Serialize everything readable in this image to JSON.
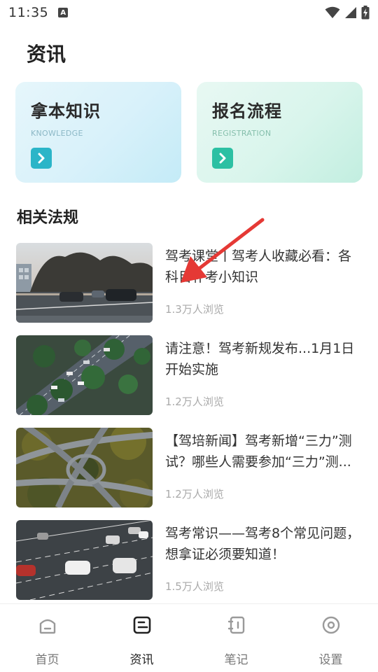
{
  "status_bar": {
    "time": "11:35",
    "notification_icon": "A",
    "icons": [
      "wifi-icon",
      "signal-icon",
      "battery-charging-icon"
    ]
  },
  "page": {
    "title": "资讯"
  },
  "cards": [
    {
      "title": "拿本知识",
      "subtitle": "KNOWLEDGE",
      "icon": "chevron-right-icon",
      "accent": "#2bb5c8"
    },
    {
      "title": "报名流程",
      "subtitle": "REGISTRATION",
      "icon": "chevron-right-icon",
      "accent": "#2cc0a3"
    }
  ],
  "section": {
    "title": "相关法规"
  },
  "news": [
    {
      "title": "驾考课堂丨驾考人收藏必看：各科目补考小知识",
      "views": "1.3万人浏览"
    },
    {
      "title": "请注意！驾考新规发布...1月1日开始实施",
      "views": "1.2万人浏览"
    },
    {
      "title": "【驾培新闻】驾考新增“三力”测试？哪些人需要参加“三力”测...",
      "views": "1.2万人浏览"
    },
    {
      "title": "驾考常识——驾考8个常见问题，想拿证必须要知道！",
      "views": "1.5万人浏览"
    }
  ],
  "bottom_nav": [
    {
      "label": "首页",
      "icon": "home-icon",
      "active": false
    },
    {
      "label": "资讯",
      "icon": "news-icon",
      "active": true
    },
    {
      "label": "笔记",
      "icon": "notebook-icon",
      "active": false
    },
    {
      "label": "设置",
      "icon": "settings-icon",
      "active": false
    }
  ],
  "colors": {
    "accent_knowledge": "#2bb5c8",
    "accent_registration": "#2cc0a3",
    "annotation_arrow": "#e53935"
  }
}
